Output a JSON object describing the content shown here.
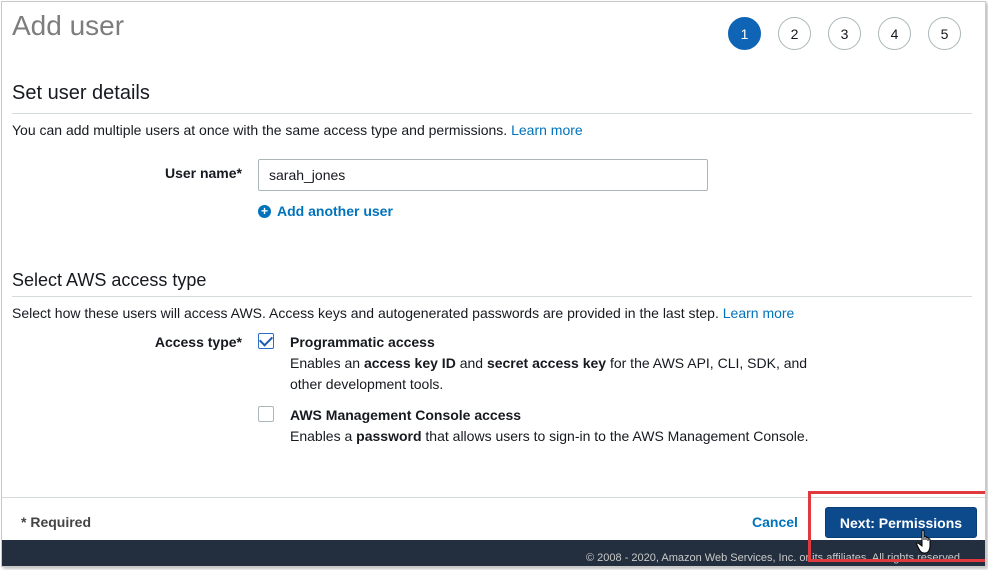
{
  "page": {
    "title": "Add user"
  },
  "steps": [
    "1",
    "2",
    "3",
    "4",
    "5"
  ],
  "active_step": "1",
  "user_details": {
    "heading": "Set user details",
    "description": "You can add multiple users at once with the same access type and permissions.",
    "learn_more": "Learn more",
    "user_name_label": "User name*",
    "user_name_value": "sarah_jones",
    "add_another_user": "Add another user"
  },
  "access_type": {
    "heading": "Select AWS access type",
    "description": "Select how these users will access AWS. Access keys and autogenerated passwords are provided in the last step.",
    "learn_more": "Learn more",
    "label": "Access type*",
    "options": [
      {
        "title": "Programmatic access",
        "checked": true,
        "desc_parts": [
          "Enables an ",
          "access key ID",
          " and ",
          "secret access key",
          " for the AWS API, CLI, SDK, and other development tools."
        ]
      },
      {
        "title": "AWS Management Console access",
        "checked": false,
        "desc_parts": [
          "Enables a ",
          "password",
          " that allows users to sign-in to the AWS Management Console."
        ]
      }
    ]
  },
  "footer": {
    "required": "* Required",
    "cancel": "Cancel",
    "next": "Next: Permissions",
    "copyright": "© 2008 - 2020, Amazon Web Services, Inc. or its affiliates. All rights reserved."
  },
  "colors": {
    "primary": "#0d4a8c",
    "link": "#0073bb",
    "active_step": "#0f64b6",
    "highlight": "#e0393e",
    "footer_bar": "#232f3e"
  }
}
